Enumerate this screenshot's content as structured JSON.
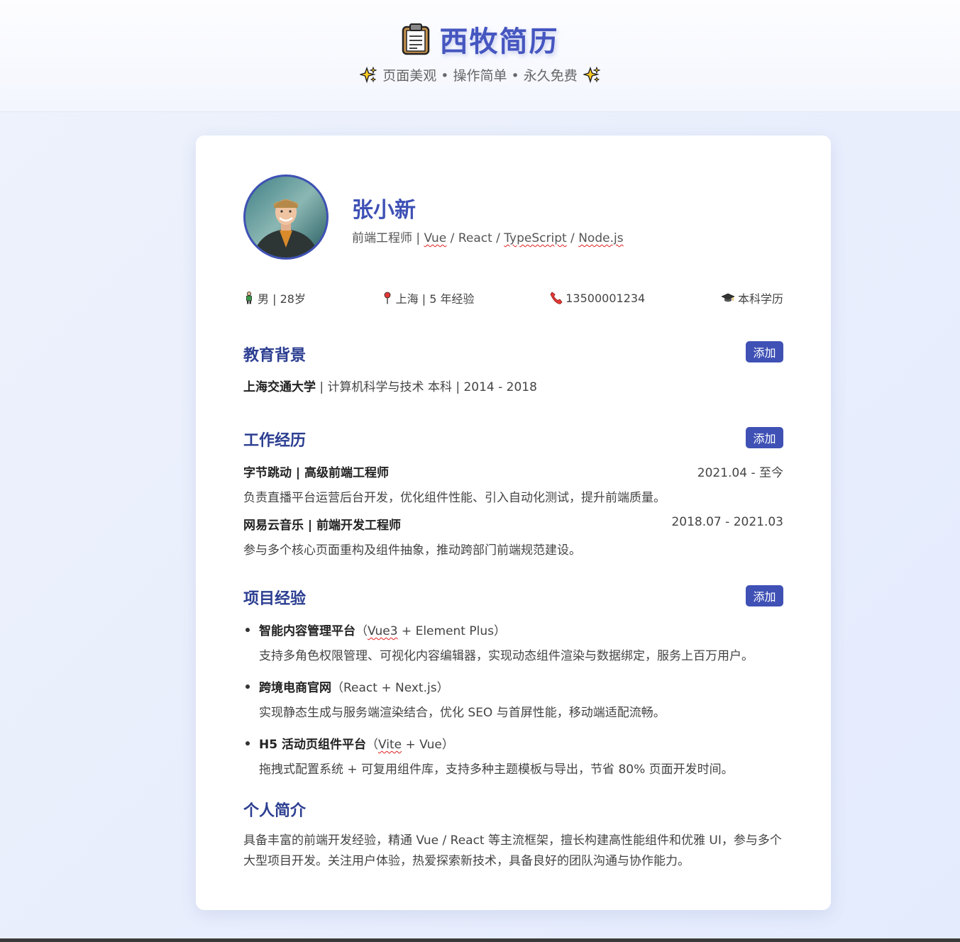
{
  "header": {
    "title": "西牧简历",
    "tagline": "页面美观 • 操作简单 • 永久免费",
    "icons": [
      "clipboard-icon",
      "sparkle-icon"
    ]
  },
  "profile": {
    "name": "张小新",
    "title_prefix": "前端工程师 | ",
    "title_tech": [
      "Vue",
      "React",
      "TypeScript",
      "Node.js"
    ],
    "title_sep": " / "
  },
  "info": {
    "gender_age": "男 | 28岁",
    "location": "上海 | 5 年经验",
    "phone": "13500001234",
    "degree": "本科学历"
  },
  "sections": {
    "education": "教育背景",
    "work": "工作经历",
    "projects": "项目经验",
    "summary": "个人简介",
    "add_label": "添加"
  },
  "education": {
    "school": "上海交通大学",
    "detail": " | 计算机科学与技术 本科 | 2014 - 2018"
  },
  "work": [
    {
      "company": "字节跳动 | 高级前端工程师",
      "period": "2021.04 - 至今",
      "desc": "负责直播平台运营后台开发，优化组件性能、引入自动化测试，提升前端质量。"
    },
    {
      "company": "网易云音乐 | 前端开发工程师",
      "period": "2018.07 - 2021.03",
      "desc": "参与多个核心页面重构及组件抽象，推动跨部门前端规范建设。"
    }
  ],
  "projects": [
    {
      "name": "智能内容管理平台",
      "stack_open": "（",
      "stack_a": "Vue3",
      "stack_b": " + Element Plus）",
      "desc": "支持多角色权限管理、可视化内容编辑器，实现动态组件渲染与数据绑定，服务上百万用户。"
    },
    {
      "name": "跨境电商官网",
      "stack_open": "（",
      "stack_a": "React",
      "stack_b": " + Next.js）",
      "desc": "实现静态生成与服务端渲染结合，优化 SEO 与首屏性能，移动端适配流畅。"
    },
    {
      "name": "H5 活动页组件平台",
      "stack_open": "（",
      "stack_a": "Vite",
      "stack_b": " + Vue）",
      "desc": "拖拽式配置系统 + 可复用组件库，支持多种主题模板与导出，节省 80% 页面开发时间。"
    }
  ],
  "summary": "具备丰富的前端开发经验，精通 Vue / React 等主流框架，擅长构建高性能组件和优雅 UI，参与多个大型项目开发。关注用户体验，热爱探索新技术，具备良好的团队沟通与协作能力。",
  "colors": {
    "accent": "#3f51b5",
    "heading": "#2c3e91"
  }
}
